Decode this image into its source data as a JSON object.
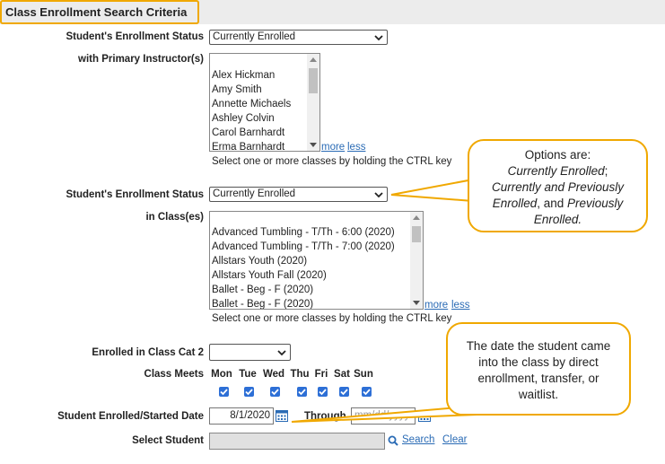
{
  "header": {
    "title": "Class Enrollment Search Criteria"
  },
  "enrollment_status_1": {
    "label": "Student's Enrollment Status",
    "value": "Currently Enrolled"
  },
  "primary_instructors": {
    "label": "with Primary Instructor(s)",
    "options": [
      "Alex Hickman",
      "Amy Smith",
      "Annette Michaels",
      "Ashley Colvin",
      "Carol Barnhardt",
      "Erma Barnhardt"
    ],
    "more": "more",
    "less": "less",
    "hint": "Select one or more classes by holding the CTRL key"
  },
  "enrollment_status_2": {
    "label": "Student's Enrollment Status",
    "value": "Currently Enrolled"
  },
  "classes": {
    "label": "in Class(es)",
    "options": [
      "Advanced Tumbling - T/Th - 6:00 (2020)",
      "Advanced Tumbling - T/Th - 7:00 (2020)",
      "Allstars Youth (2020)",
      "Allstars Youth Fall (2020)",
      "Ballet - Beg - F (2020)",
      "Ballet - Beg - F (2020)"
    ],
    "more": "more",
    "less": "less",
    "hint": "Select one or more classes by holding the CTRL key"
  },
  "class_cat2": {
    "label": "Enrolled in Class Cat 2",
    "value": ""
  },
  "class_meets": {
    "label": "Class Meets",
    "days": [
      "Mon",
      "Tue",
      "Wed",
      "Thu",
      "Fri",
      "Sat",
      "Sun"
    ],
    "checked": [
      true,
      true,
      true,
      true,
      true,
      true,
      true
    ]
  },
  "start_date": {
    "label": "Student Enrolled/Started Date",
    "value": "8/1/2020",
    "through_label": "Through",
    "through_placeholder": "mm/dd/yyyy"
  },
  "select_student": {
    "label": "Select Student",
    "value": "",
    "search": "Search",
    "clear": "Clear"
  },
  "callouts": {
    "status": {
      "line1": "Options are:",
      "line2": "Currently Enrolled",
      "line2_suffix": ";",
      "line3": "Currently and Previously",
      "line4": "Enrolled",
      "line4_suffix": ", and ",
      "line4b": "Previously",
      "line5": "Enrolled."
    },
    "date": {
      "line1": "The date the student came",
      "line2": "into the class by direct",
      "line3": "enrollment, transfer, or",
      "line4": "waitlist."
    }
  },
  "colors": {
    "highlight": "#f0a800",
    "link": "#2a6bb5",
    "checkbox": "#2d6fd6"
  }
}
